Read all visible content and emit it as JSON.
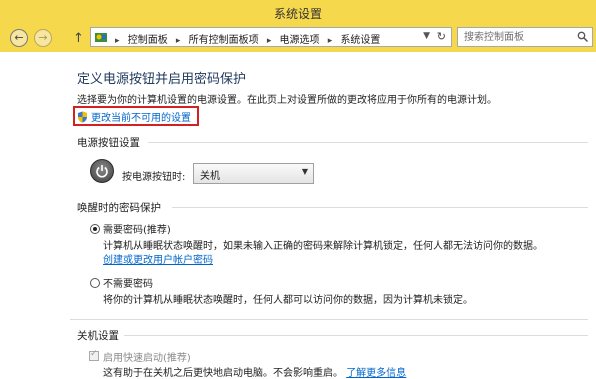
{
  "window": {
    "title": "系统设置"
  },
  "nav": {
    "back_icon": "arrow-left-icon",
    "forward_icon": "arrow-right-icon",
    "up_icon": "arrow-up-icon"
  },
  "address": {
    "breadcrumbs": [
      "控制面板",
      "所有控制面板项",
      "电源选项",
      "系统设置"
    ],
    "refresh_icon": "refresh-icon"
  },
  "search": {
    "placeholder": "搜索控制面板"
  },
  "main": {
    "heading": "定义电源按钮并启用密码保护",
    "description": "选择要为你的计算机设置的电源设置。在此页上对设置所做的更改将应用于你所有的电源计划。",
    "change_link": "更改当前不可用的设置",
    "highlight_color": "#d32020"
  },
  "power_button": {
    "section": "电源按钮设置",
    "label": "按电源按钮时:",
    "selected": "关机"
  },
  "wake_password": {
    "section": "唤醒时的密码保护",
    "require": {
      "label": "需要密码(推荐)",
      "checked": true,
      "desc": "计算机从睡眠状态唤醒时，如果未输入正确的密码来解除计算机锁定，任何人都无法访问你的数据。",
      "link": "创建或更改用户帐户密码"
    },
    "no_require": {
      "label": "不需要密码",
      "checked": false,
      "desc": "将你的计算机从睡眠状态唤醒时，任何人都可以访问你的数据，因为计算机未锁定。"
    }
  },
  "shutdown": {
    "section": "关机设置",
    "fast_startup": {
      "label": "启用快速启动(推荐)",
      "checked": true,
      "desc": "这有助于在关机之后更快地启动电脑。不会影响重启。",
      "link": "了解更多信息"
    }
  },
  "colors": {
    "titlebar": "#f6d84c",
    "link": "#0066cc",
    "heading": "#1e395b"
  }
}
